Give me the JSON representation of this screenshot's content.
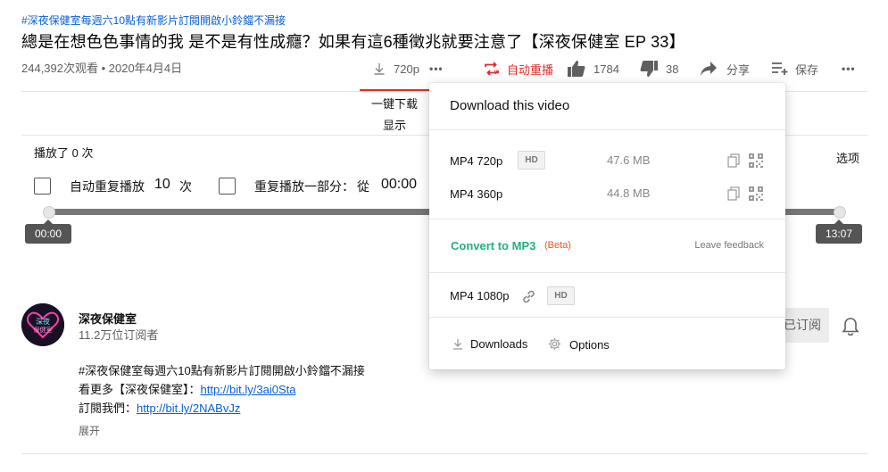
{
  "video": {
    "hashtag": "#深夜保健室每週六10點有新影片訂閱開啟小鈴鐺不漏接",
    "title": "總是在想色色事情的我 是不是有性成癮？如果有這6種徵兆就要注意了【深夜保健室 EP 33】",
    "views_date": "244,392次观看 • 2020年4月4日"
  },
  "actions": {
    "quality": "720p",
    "more": "•••",
    "autoplay_repeat": "自动重播",
    "likes": "1784",
    "dislikes": "38",
    "share": "分享",
    "save": "保存",
    "menu": "•••"
  },
  "extension": {
    "line1": "一键下载",
    "line2": "显示"
  },
  "loop_panel": {
    "played": "播放了 0 次",
    "options": "选项",
    "auto_repeat_label": "自动重复播放",
    "repeat_count": "10",
    "times_unit": "次",
    "partial_repeat_label": "重复播放一部分：",
    "from_label": "從",
    "from_time": "00:00",
    "start_time": "00:00",
    "end_time": "13:07"
  },
  "channel": {
    "name": "深夜保健室",
    "subscribers": "11.2万位订阅者",
    "avatar_text": "深夜\n保健室",
    "subscribe_label": "已订阅"
  },
  "description": {
    "line1": "#深夜保健室每週六10點有新影片訂閱開啟小鈴鐺不漏接",
    "line2_prefix": "看更多【深夜保健室】：",
    "line2_link": "http://bit.ly/3ai0Sta",
    "line3_prefix": "訂閱我們：",
    "line3_link": "http://bit.ly/2NABvJz",
    "expand": "展开"
  },
  "popup": {
    "title": "Download this video",
    "formats": [
      {
        "label": "MP4 720p",
        "badge": "HD",
        "size": "47.6 MB"
      },
      {
        "label": "MP4 360p",
        "size": "44.8 MB"
      }
    ],
    "mp3_label": "Convert to MP3",
    "beta_label": "(Beta)",
    "feedback_label": "Leave feedback",
    "hd_format": {
      "label": "MP4 1080p",
      "badge": "HD"
    },
    "downloads_label": "Downloads",
    "options_label": "Options"
  },
  "colors": {
    "accent_red": "#e02b2b",
    "mp3_green": "#22b07d",
    "beta_orange": "#e8541e",
    "link_blue": "#065fd4"
  }
}
